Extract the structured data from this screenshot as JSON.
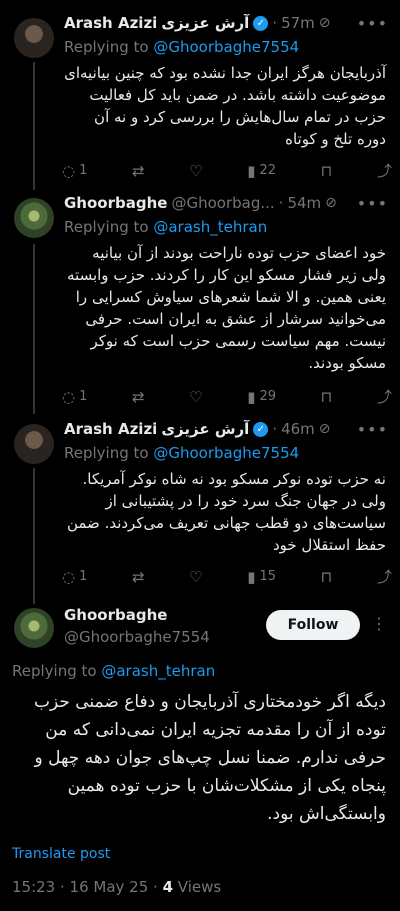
{
  "tweets": [
    {
      "name": "Arash Azizi",
      "name_fa": "آرش عزیزی",
      "handle": "",
      "time": "57m",
      "replying_label": "Replying to",
      "replying_to": "@Ghoorbaghe7554",
      "text": "آذربایجان هرگز ایران جدا نشده بود که چنین بیانیه‌ای موضوعیت داشته باشد. در ضمن باید کل فعالیت حزب در تمام سال‌هایش را بررسی کرد و نه آن دوره تلخ و کوتاه",
      "replies": "1",
      "reposts": "",
      "likes": "",
      "views": "22"
    },
    {
      "name": "Ghoorbaghe",
      "handle": "@Ghoorbag...",
      "time": "54m",
      "replying_label": "Replying to",
      "replying_to": "@arash_tehran",
      "text": "خود اعضای حزب توده ناراحت بودند از آن بیانیه ولی زیر فشار مسکو این کار را کردند. حزب وابسته یعنی همین. و الا شما شعرهای سیاوش کسرایی را می‌خوانید سرشار از عشق به ایران است. حرفی نیست. مهم سیاست رسمی حزب است که نوکر مسکو بودند.",
      "replies": "1",
      "reposts": "",
      "likes": "",
      "views": "29"
    },
    {
      "name": "Arash Azizi",
      "name_fa": "آرش عزیزی",
      "handle": "",
      "time": "46m",
      "replying_label": "Replying to",
      "replying_to": "@Ghoorbaghe7554",
      "text": "نه حزب توده نوکر مسکو بود نه شاه نوکر آمریکا. ولی در جهان جنگ سرد خود را در پشتیبانی از سیاست‌های دو قطب جهانی تعریف می‌کردند. ضمن حفظ استقلال خود",
      "replies": "1",
      "reposts": "",
      "likes": "",
      "views": "15"
    }
  ],
  "main": {
    "name": "Ghoorbaghe",
    "handle": "@Ghoorbaghe7554",
    "follow_label": "Follow",
    "replying_label": "Replying to",
    "replying_to": "@arash_tehran",
    "text": "دیگه اگر خودمختاری آذربایجان و دفاع ضمنی حزب توده از آن را مقدمه تجزیه ایران نمی‌دانی که من حرفی ندارم. ضمنا نسل چپ‌های جوان دهه چهل و پنجاه یکی از مشکلات‌شان با حزب توده همین وابستگی‌اش بود.",
    "translate_label": "Translate post",
    "timestamp": "15:23 · 16 May 25 · ",
    "views_count": "4",
    "views_label": " Views"
  },
  "icons": {
    "reply": "speech-bubble-icon",
    "repost": "repost-arrows-icon",
    "like": "heart-icon",
    "views": "bar-chart-icon",
    "bookmark": "bookmark-icon",
    "share": "share-arrow-icon",
    "verified": "verified-badge-icon",
    "grok": "grok-icon",
    "more": "more-dots-icon"
  },
  "colors": {
    "background": "#000000",
    "text": "#e7e9ea",
    "muted": "#71767b",
    "accent": "#1d9bf0"
  }
}
